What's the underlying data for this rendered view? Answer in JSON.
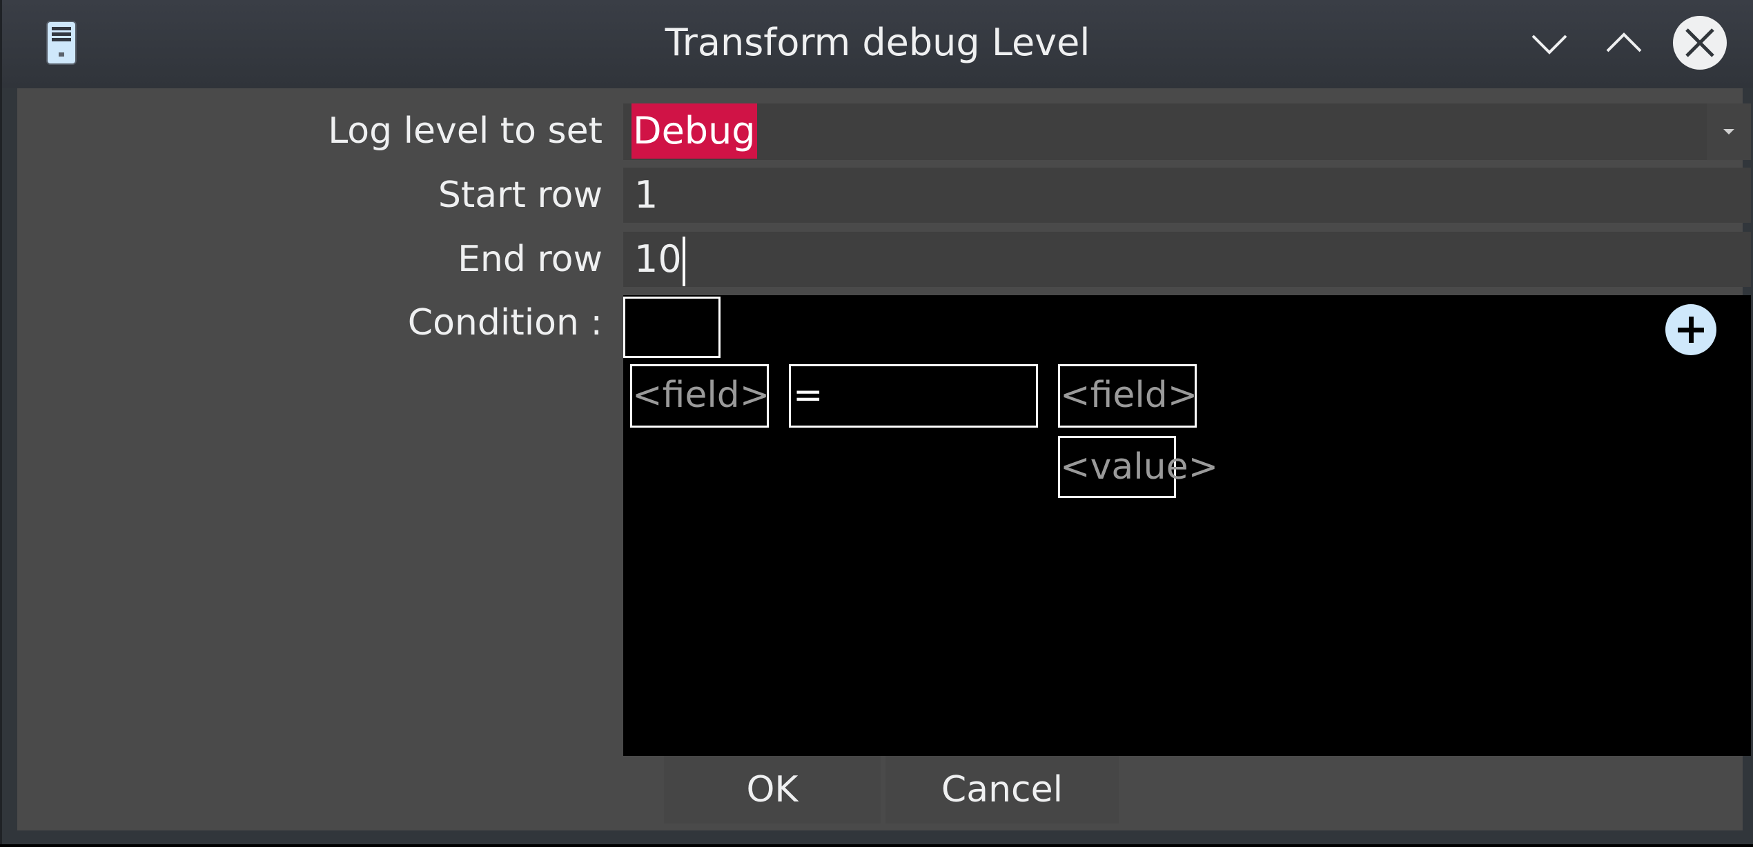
{
  "window": {
    "title": "Transform debug Level",
    "app_icon": "server-tower-icon",
    "controls": {
      "minimize": "chevron-down-icon",
      "maximize": "chevron-up-icon",
      "close": "close-circle-icon"
    }
  },
  "form": {
    "log_level": {
      "label": "Log level to set",
      "value": "Debug",
      "highlight_color": "#d01346"
    },
    "start_row": {
      "label": "Start row",
      "value": "1"
    },
    "end_row": {
      "label": "End row",
      "value": "10"
    },
    "condition": {
      "label": "Condition :",
      "negate_box": "",
      "left_field": "<field>",
      "operator": "=",
      "right_field": "<field>",
      "right_value": "<value>",
      "add_icon": "plus-circle-icon"
    }
  },
  "buttons": {
    "ok": "OK",
    "cancel": "Cancel"
  }
}
